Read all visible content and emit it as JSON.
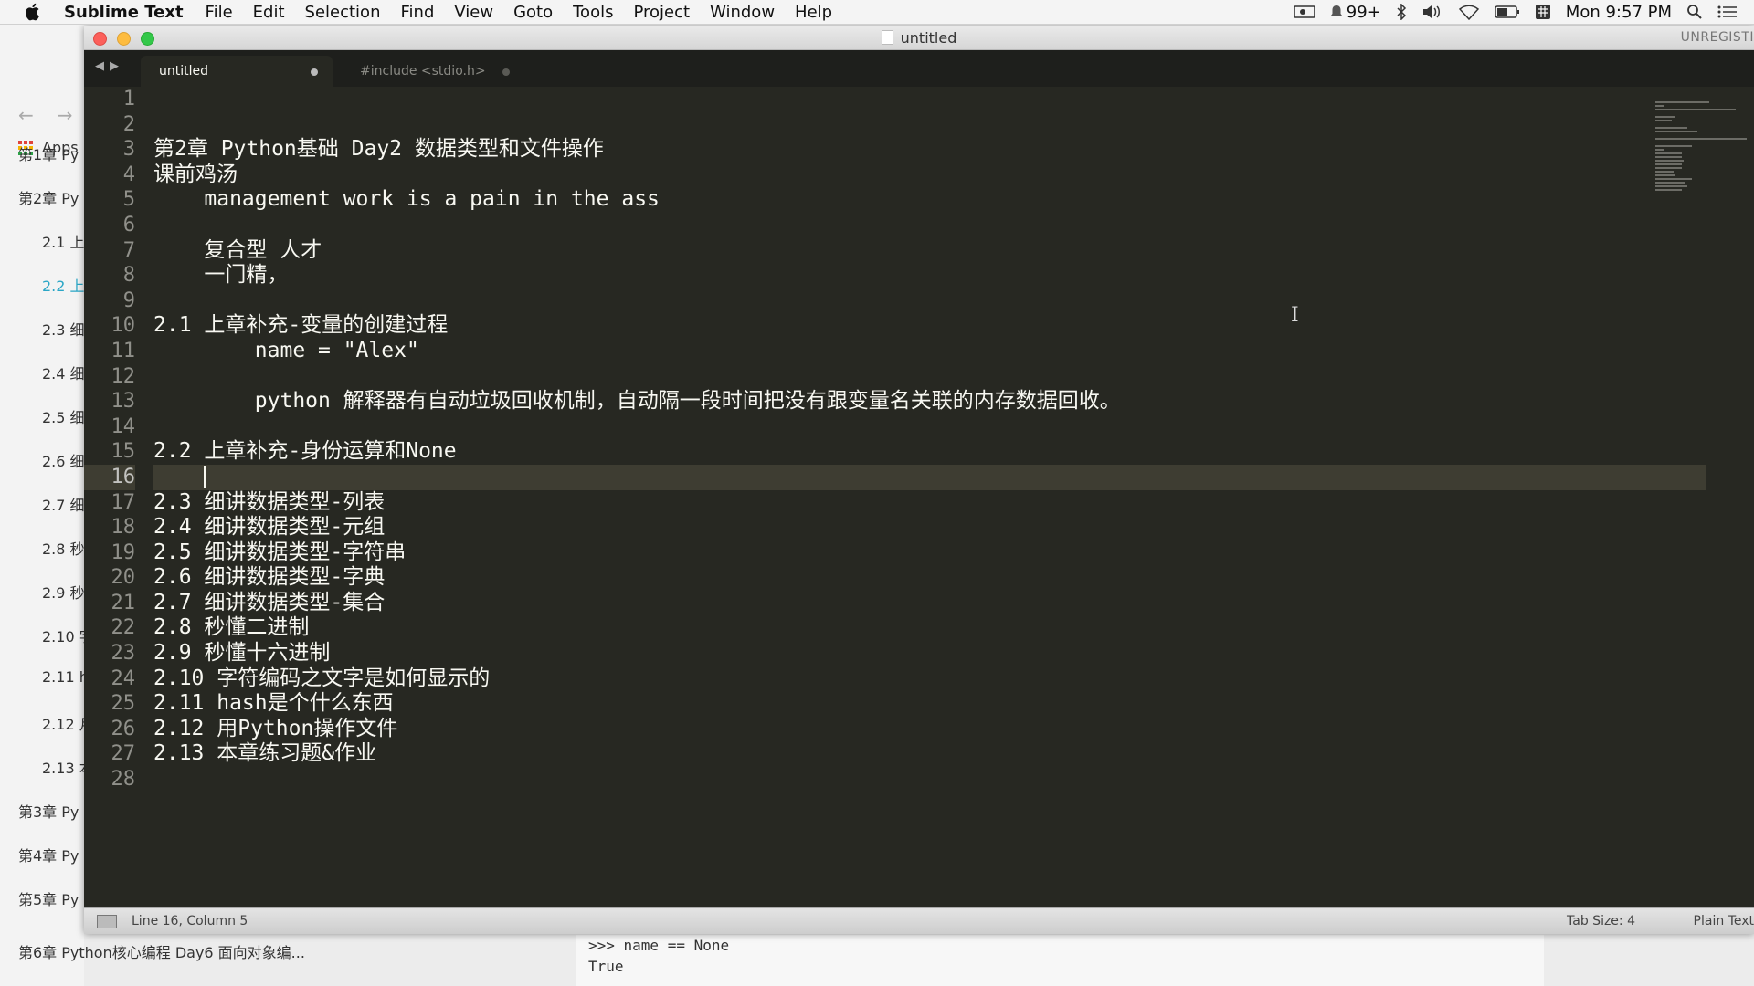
{
  "menubar": {
    "app_name": "Sublime Text",
    "items": [
      "File",
      "Edit",
      "Selection",
      "Find",
      "View",
      "Goto",
      "Tools",
      "Project",
      "Window",
      "Help"
    ],
    "notifications": "99+",
    "clock": "Mon 9:57 PM"
  },
  "background_browser": {
    "apps_label": "Apps",
    "toc": [
      "第1章 Py",
      "第2章 Py",
      "2.1 上",
      "2.2 上",
      "2.3 细",
      "2.4 细",
      "2.5 细",
      "2.6 细",
      "2.7 细",
      "2.8 秒",
      "2.9 秒",
      "2.10 字",
      "2.11 h",
      "2.12 月",
      "2.13 本",
      "第3章 Py",
      "第4章 Py",
      "第5章 Py"
    ],
    "bottom_item": "第6章 Python核心编程 Day6 面向对象编...",
    "console_lines": [
      ">>> name == None",
      "True"
    ]
  },
  "window": {
    "title": "untitled",
    "unregistered": "UNREGISTI",
    "tabs": [
      {
        "label": "untitled",
        "active": true
      },
      {
        "label": "#include <stdio.h>",
        "active": false
      }
    ]
  },
  "editor": {
    "current_line": 16,
    "lines": [
      "",
      "",
      "第2章 Python基础 Day2 数据类型和文件操作",
      "课前鸡汤",
      "    management work is a pain in the ass",
      "",
      "    复合型 人才",
      "    一门精，",
      "",
      "2.1 上章补充-变量的创建过程",
      "        name = \"Alex\"",
      "",
      "        python 解释器有自动垃圾回收机制，自动隔一段时间把没有跟变量名关联的内存数据回收。",
      "",
      "2.2 上章补充-身份运算和None",
      "    ",
      "2.3 细讲数据类型-列表",
      "2.4 细讲数据类型-元组",
      "2.5 细讲数据类型-字符串",
      "2.6 细讲数据类型-字典",
      "2.7 细讲数据类型-集合",
      "2.8 秒懂二进制",
      "2.9 秒懂十六进制",
      "2.10 字符编码之文字是如何显示的",
      "2.11 hash是个什么东西",
      "2.12 用Python操作文件",
      "2.13 本章练习题&作业",
      ""
    ]
  },
  "statusbar": {
    "position": "Line 16, Column 5",
    "tab_size": "Tab Size: 4",
    "syntax": "Plain Text"
  }
}
